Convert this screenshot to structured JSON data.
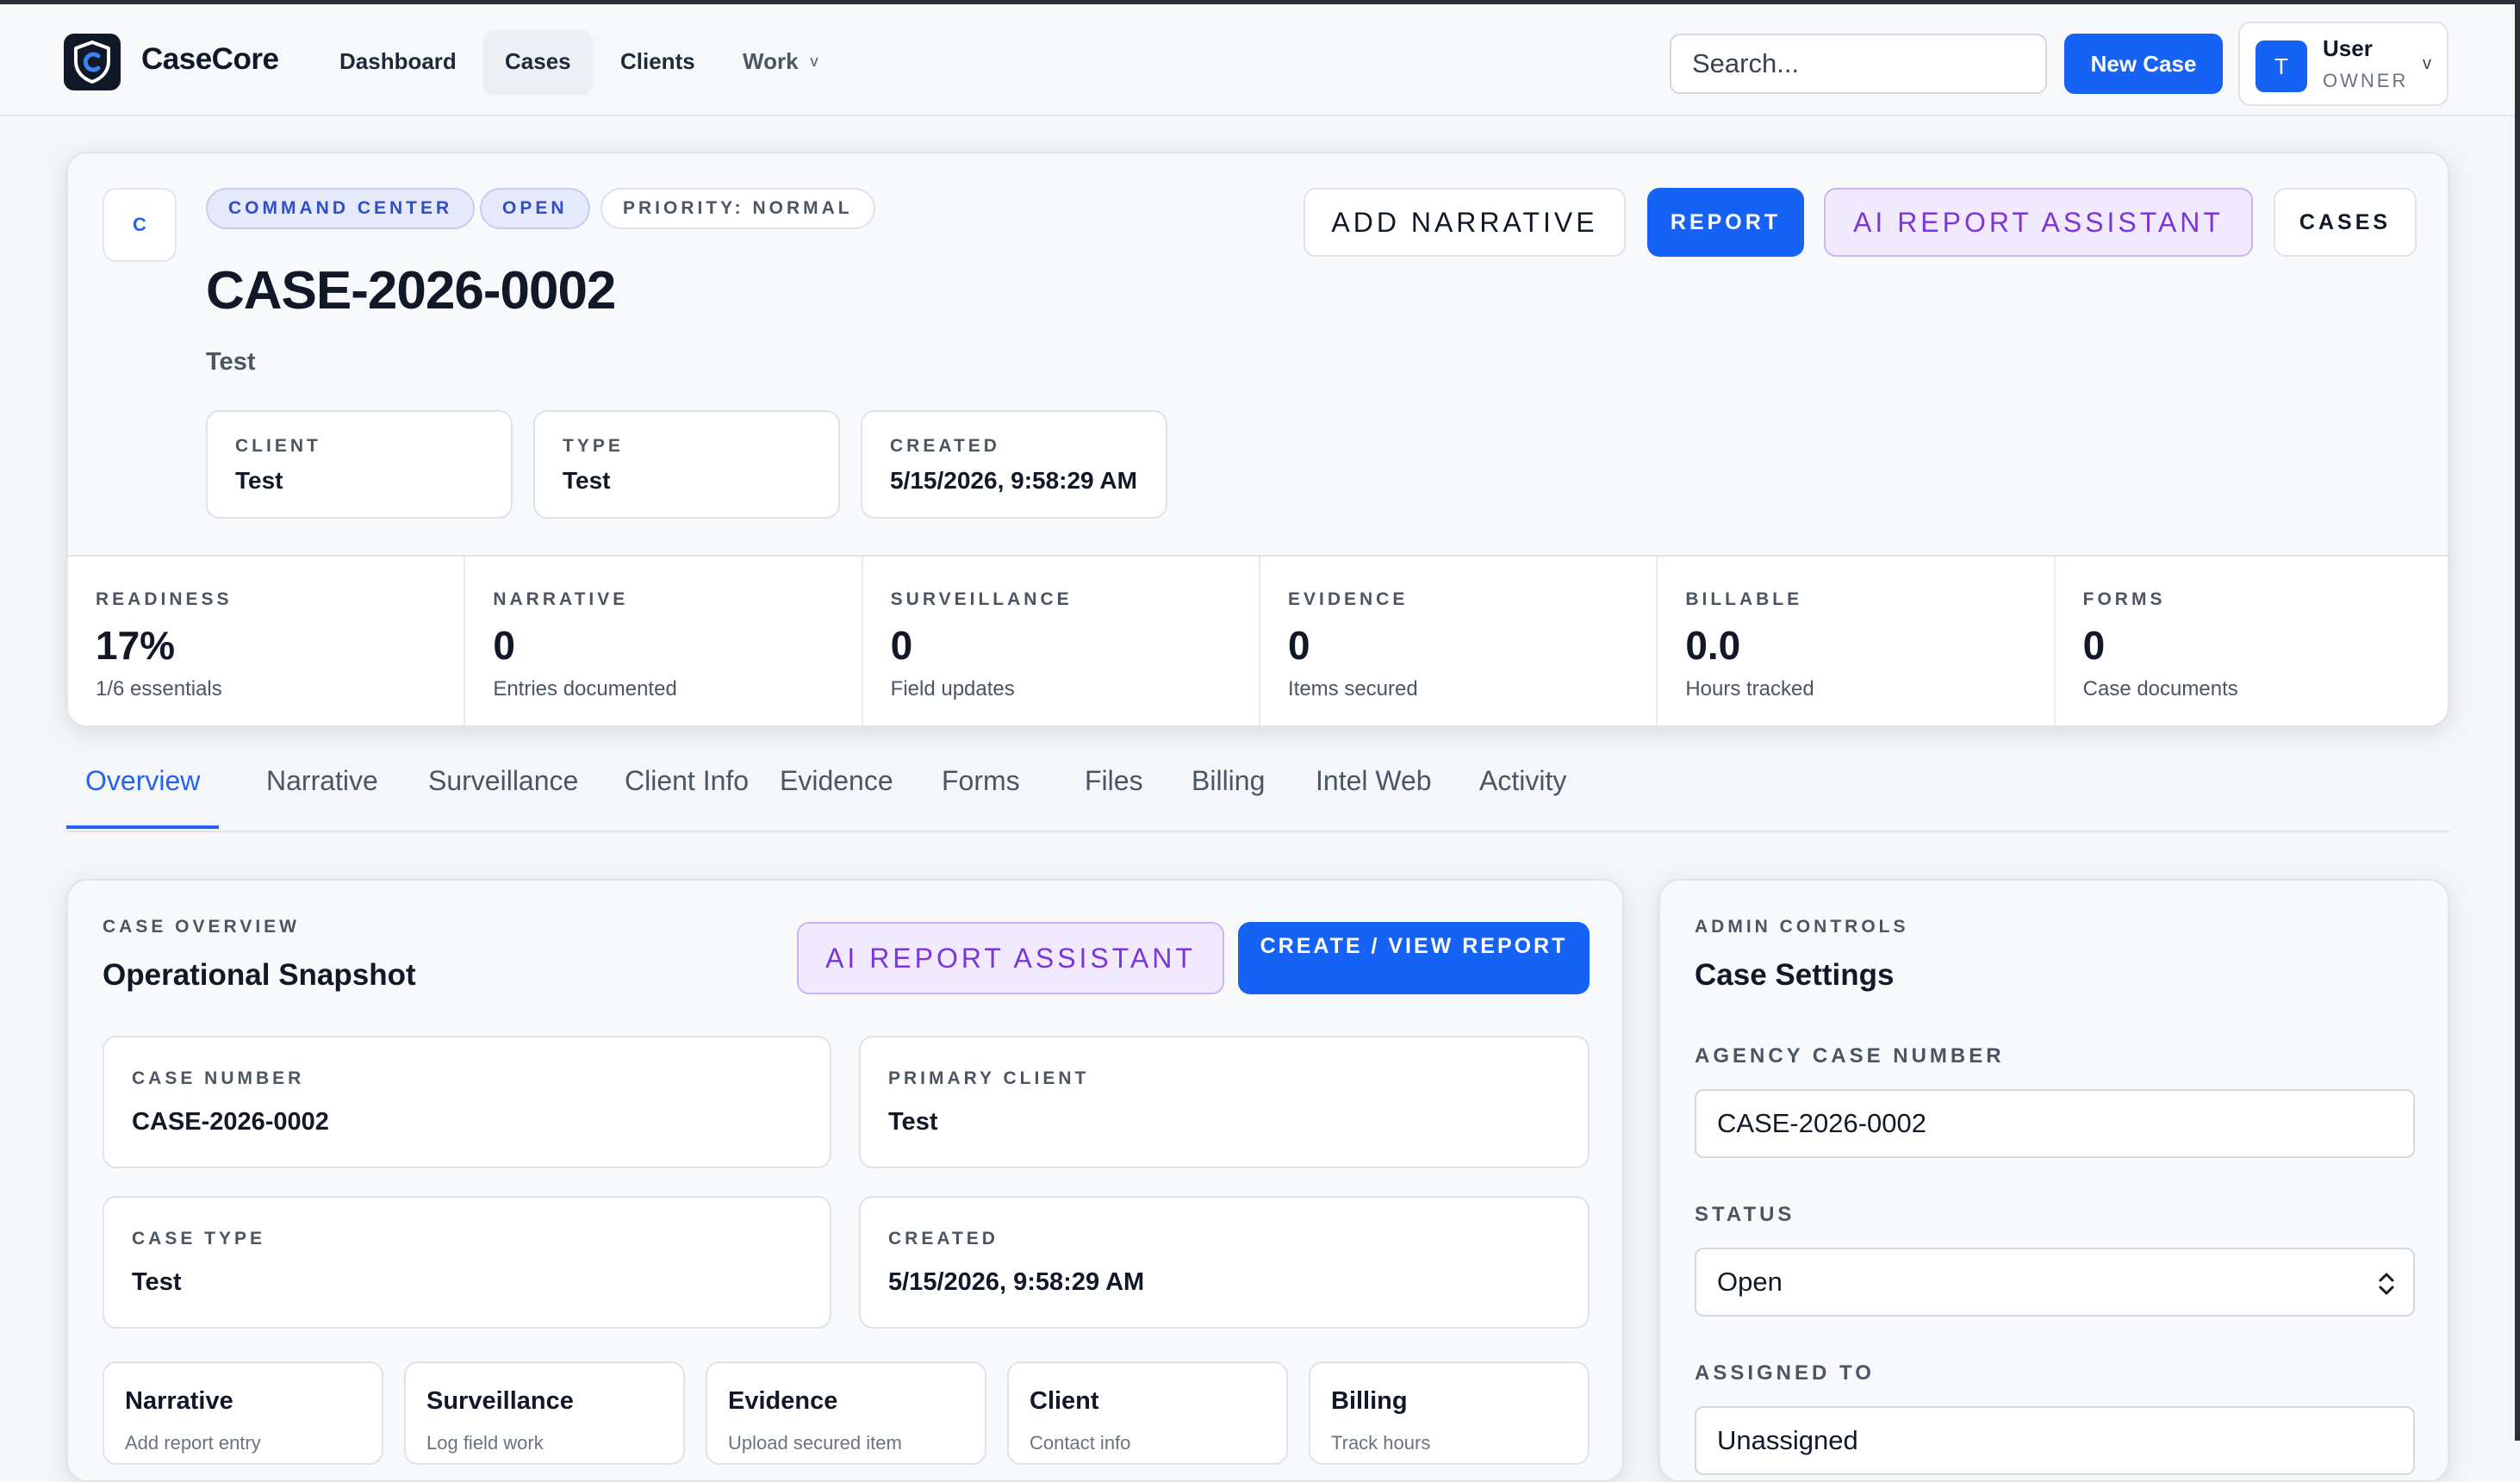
{
  "header": {
    "brand": "CaseCore",
    "nav": [
      {
        "label": "Dashboard"
      },
      {
        "label": "Cases"
      },
      {
        "label": "Clients"
      },
      {
        "label": "Work",
        "chevron": "v"
      }
    ],
    "search_placeholder": "Search...",
    "new_case_label": "New Case",
    "user": {
      "initial": "T",
      "name": "User",
      "role": "OWNER",
      "chevron": "v"
    }
  },
  "case": {
    "badge": "C",
    "pills": [
      "COMMAND CENTER",
      "OPEN",
      "PRIORITY: NORMAL"
    ],
    "title": "CASE-2026-0002",
    "subtitle": "Test",
    "info": [
      {
        "label": "CLIENT",
        "value": "Test"
      },
      {
        "label": "TYPE",
        "value": "Test"
      },
      {
        "label": "CREATED",
        "value": "5/15/2026, 9:58:29 AM"
      }
    ],
    "actions": {
      "add_narrative": "ADD NARRATIVE",
      "report": "REPORT",
      "ai_assistant": "AI REPORT ASSISTANT",
      "cases": "CASES"
    },
    "stats": [
      {
        "label": "READINESS",
        "value": "17%",
        "note": "1/6 essentials"
      },
      {
        "label": "NARRATIVE",
        "value": "0",
        "note": "Entries documented"
      },
      {
        "label": "SURVEILLANCE",
        "value": "0",
        "note": "Field updates"
      },
      {
        "label": "EVIDENCE",
        "value": "0",
        "note": "Items secured"
      },
      {
        "label": "BILLABLE",
        "value": "0.0",
        "note": "Hours tracked"
      },
      {
        "label": "FORMS",
        "value": "0",
        "note": "Case documents"
      }
    ]
  },
  "tabs": [
    "Overview",
    "Narrative",
    "Surveillance",
    "Client Info",
    "Evidence",
    "Forms",
    "Files",
    "Billing",
    "Intel Web",
    "Activity"
  ],
  "overview": {
    "eyebrow": "CASE OVERVIEW",
    "title": "Operational Snapshot",
    "ai_button": "AI REPORT ASSISTANT",
    "report_button": "CREATE / VIEW REPORT",
    "fields": [
      {
        "label": "CASE NUMBER",
        "value": "CASE-2026-0002"
      },
      {
        "label": "PRIMARY CLIENT",
        "value": "Test"
      },
      {
        "label": "CASE TYPE",
        "value": "Test"
      },
      {
        "label": "CREATED",
        "value": "5/15/2026, 9:58:29 AM"
      }
    ],
    "quick": [
      {
        "title": "Narrative",
        "desc": "Add report entry"
      },
      {
        "title": "Surveillance",
        "desc": "Log field work"
      },
      {
        "title": "Evidence",
        "desc": "Upload secured item"
      },
      {
        "title": "Client",
        "desc": "Contact info"
      },
      {
        "title": "Billing",
        "desc": "Track hours"
      }
    ]
  },
  "admin": {
    "eyebrow": "ADMIN CONTROLS",
    "title": "Case Settings",
    "agency_label": "AGENCY CASE NUMBER",
    "agency_value": "CASE-2026-0002",
    "status_label": "STATUS",
    "status_value": "Open",
    "assigned_label": "ASSIGNED TO",
    "assigned_value": "Unassigned"
  }
}
